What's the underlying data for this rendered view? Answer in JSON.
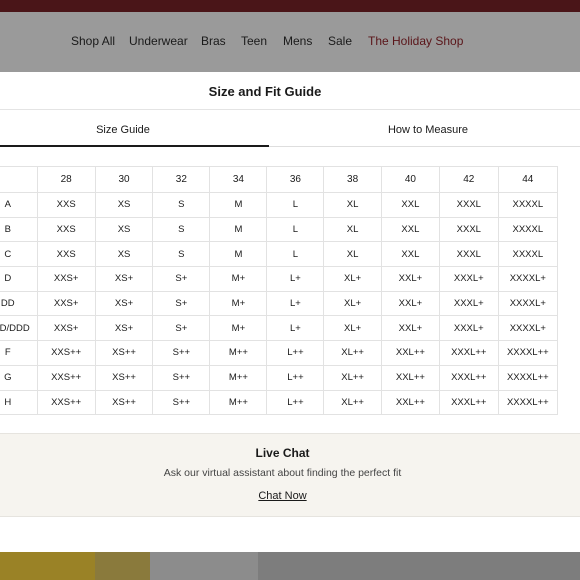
{
  "nav": {
    "items": [
      "Shop All",
      "Underwear",
      "Bras",
      "Teen",
      "Mens",
      "Sale",
      "The Holiday Shop"
    ]
  },
  "modal": {
    "title": "Size and Fit Guide",
    "tabs": [
      {
        "label": "Size Guide",
        "active": true
      },
      {
        "label": "How to Measure",
        "active": false
      }
    ]
  },
  "size_table": {
    "band_sizes": [
      "28",
      "30",
      "32",
      "34",
      "36",
      "38",
      "40",
      "42",
      "44"
    ],
    "rows": [
      {
        "cup": "A",
        "sizes": [
          "XXS",
          "XS",
          "S",
          "M",
          "L",
          "XL",
          "XXL",
          "XXXL",
          "XXXXL"
        ]
      },
      {
        "cup": "B",
        "sizes": [
          "XXS",
          "XS",
          "S",
          "M",
          "L",
          "XL",
          "XXL",
          "XXXL",
          "XXXXL"
        ]
      },
      {
        "cup": "C",
        "sizes": [
          "XXS",
          "XS",
          "S",
          "M",
          "L",
          "XL",
          "XXL",
          "XXXL",
          "XXXXL"
        ]
      },
      {
        "cup": "D",
        "sizes": [
          "XXS+",
          "XS+",
          "S+",
          "M+",
          "L+",
          "XL+",
          "XXL+",
          "XXXL+",
          "XXXXL+"
        ]
      },
      {
        "cup": "DD",
        "sizes": [
          "XXS+",
          "XS+",
          "S+",
          "M+",
          "L+",
          "XL+",
          "XXL+",
          "XXXL+",
          "XXXXL+"
        ]
      },
      {
        "cup": "DDD/DDD",
        "sizes": [
          "XXS+",
          "XS+",
          "S+",
          "M+",
          "L+",
          "XL+",
          "XXL+",
          "XXXL+",
          "XXXXL+"
        ]
      },
      {
        "cup": "F",
        "sizes": [
          "XXS++",
          "XS++",
          "S++",
          "M++",
          "L++",
          "XL++",
          "XXL++",
          "XXXL++",
          "XXXXL++"
        ]
      },
      {
        "cup": "G",
        "sizes": [
          "XXS++",
          "XS++",
          "S++",
          "M++",
          "L++",
          "XL++",
          "XXL++",
          "XXXL++",
          "XXXXL++"
        ]
      },
      {
        "cup": "H",
        "sizes": [
          "XXS++",
          "XS++",
          "S++",
          "M++",
          "L++",
          "XL++",
          "XXL++",
          "XXXL++",
          "XXXXL++"
        ]
      }
    ]
  },
  "live_chat": {
    "title": "Live Chat",
    "subtitle": "Ask our virtual assistant about finding the perfect fit",
    "link_label": "Chat Now"
  },
  "colors": {
    "topbar": "#4a1518",
    "holiday_link": "#5a1519",
    "overlay": "#9a9a9a",
    "chat_bg": "#f6f4ef"
  }
}
